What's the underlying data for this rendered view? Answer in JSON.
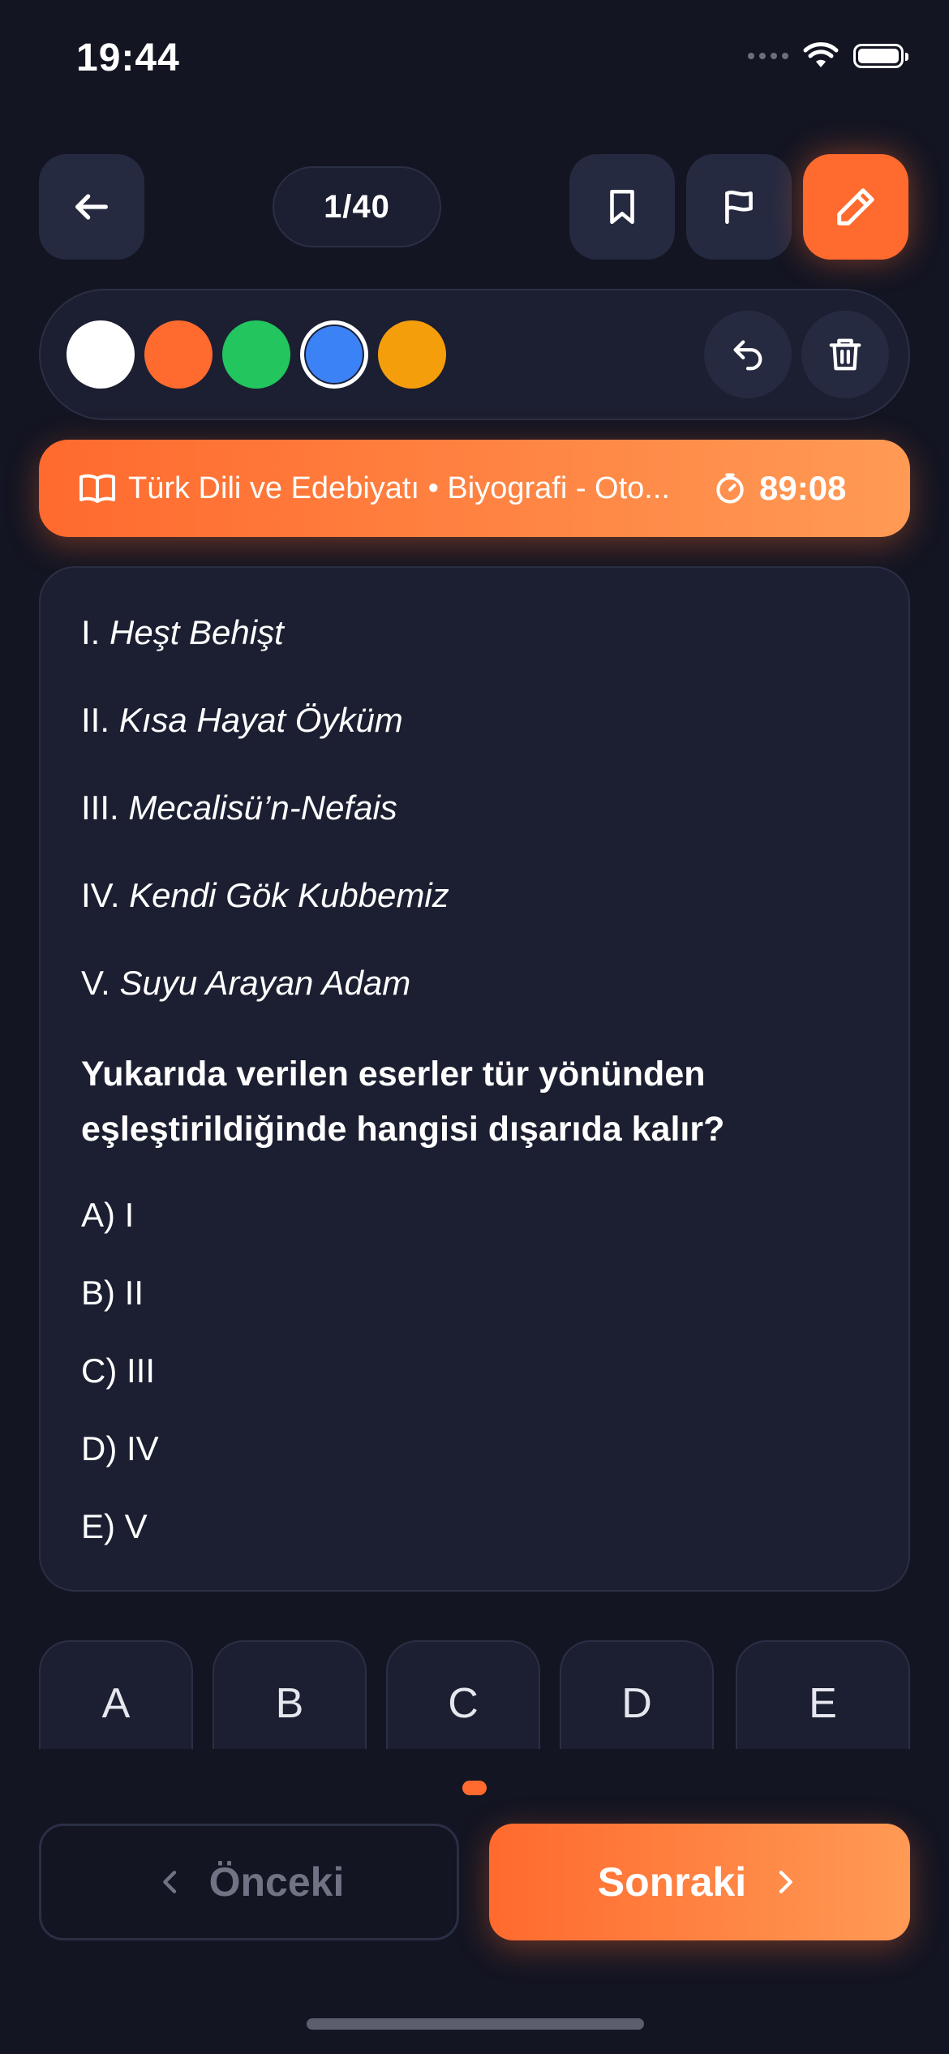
{
  "status": {
    "time": "19:44"
  },
  "toolbar": {
    "counter": "1/40",
    "icons": [
      "arrow-left-icon",
      "bookmark-icon",
      "flag-icon",
      "pencil-icon"
    ]
  },
  "palette": {
    "colors": [
      "#FFFFFF",
      "#FF6A2E",
      "#22C55E",
      "#3B82F6",
      "#F59E0B"
    ],
    "selected_color": "#3B82F6",
    "icons": [
      "undo-icon",
      "trash-icon"
    ]
  },
  "banner": {
    "topic": "Türk Dili ve Edebiyatı • Biyografi - Oto...",
    "timer": "89:08"
  },
  "question": {
    "items": [
      {
        "num": "I.",
        "title": "Heşt Behişt"
      },
      {
        "num": "II.",
        "title": "Kısa Hayat Öyküm"
      },
      {
        "num": "III.",
        "title": "Mecalisü’n-Nefais"
      },
      {
        "num": "IV.",
        "title": "Kendi Gök Kubbemiz"
      },
      {
        "num": "V.",
        "title": "Suyu Arayan Adam"
      }
    ],
    "text": "Yukarıda verilen eserler tür yönünden eşleştirildiğinde hangisi dışarıda kalır?",
    "options": [
      "A) I",
      "B) II",
      "C) III",
      "D) IV",
      "E) V"
    ]
  },
  "answers": [
    "A",
    "B",
    "C",
    "D",
    "E"
  ],
  "nav": {
    "prev": "Önceki",
    "next": "Sonraki"
  }
}
